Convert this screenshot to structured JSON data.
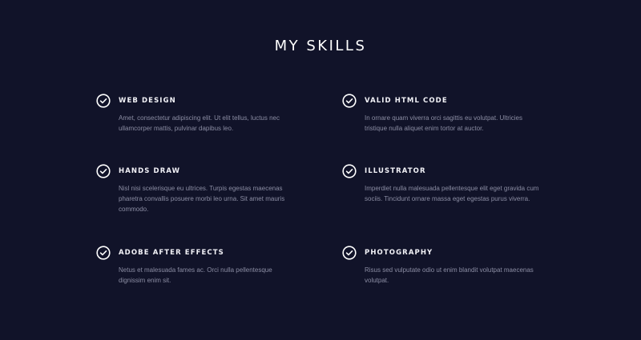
{
  "section": {
    "title": "MY SKILLS"
  },
  "icons": {
    "check": "check-circle-icon"
  },
  "colors": {
    "background": "#111329",
    "heading": "#ffffff",
    "text": "#8b8da3"
  },
  "skills": [
    {
      "name": "WEB DESIGN",
      "description": "Amet, consectetur adipiscing elit. Ut elit tellus, luctus nec ullamcorper mattis, pulvinar dapibus leo."
    },
    {
      "name": "VALID HTML CODE",
      "description": "In ornare quam viverra orci sagittis eu volutpat. Ultricies tristique nulla aliquet enim tortor at auctor."
    },
    {
      "name": "HANDS DRAW",
      "description": "Nisl nisi scelerisque eu ultrices. Turpis egestas maecenas pharetra convallis posuere morbi leo urna. Sit amet mauris commodo."
    },
    {
      "name": "ILLUSTRATOR",
      "description": "Imperdiet nulla malesuada pellentesque elit eget gravida cum sociis. Tincidunt ornare massa eget egestas purus viverra."
    },
    {
      "name": "ADOBE AFTER EFFECTS",
      "description": "Netus et malesuada fames ac. Orci nulla pellentesque dignissim enim sit."
    },
    {
      "name": "PHOTOGRAPHY",
      "description": "Risus sed vulputate odio ut enim blandit volutpat maecenas volutpat."
    }
  ]
}
